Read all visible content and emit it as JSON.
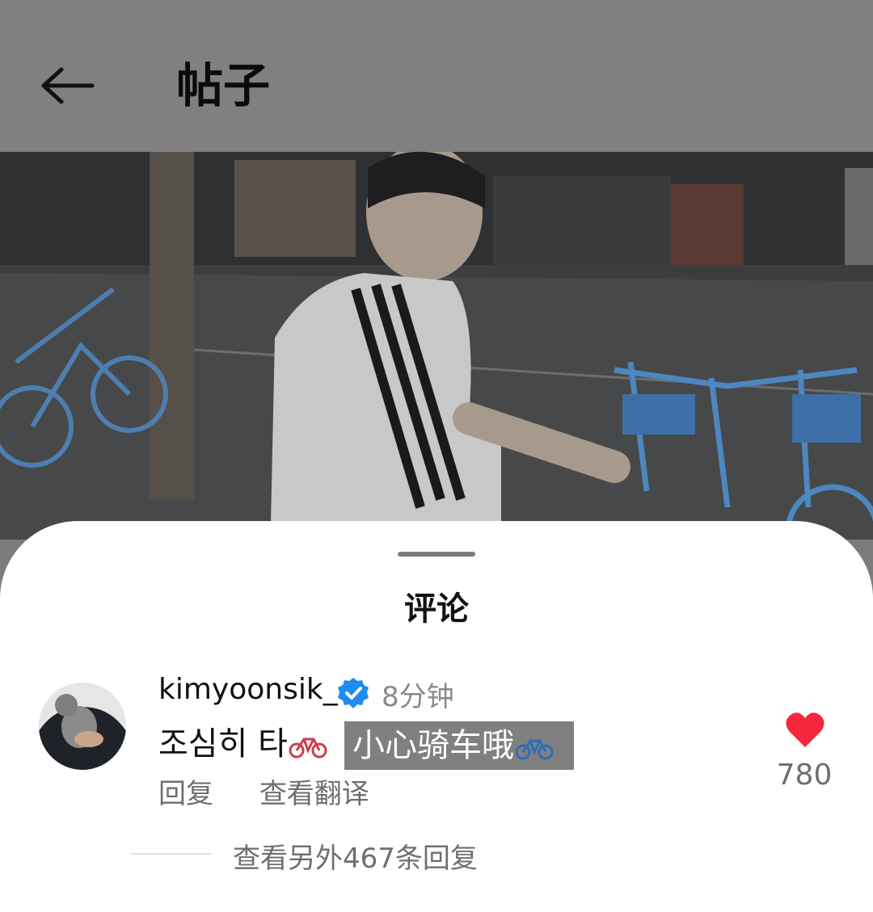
{
  "header": {
    "title": "帖子",
    "back_icon": "arrow-left-icon"
  },
  "photo": {
    "description_icon": "photo"
  },
  "comments_sheet": {
    "title": "评论",
    "comment": {
      "username": "kimyoonsik_",
      "time": "8分钟",
      "text": "조심히 타",
      "translation": "小心骑车哦",
      "reply_label": "回复",
      "translate_label": "查看翻译",
      "like_count": "780"
    },
    "more_replies": "查看另外467条回复"
  },
  "colors": {
    "heart": "#f4273c",
    "verified": "#1f8cf0",
    "overlay": "#808080"
  }
}
